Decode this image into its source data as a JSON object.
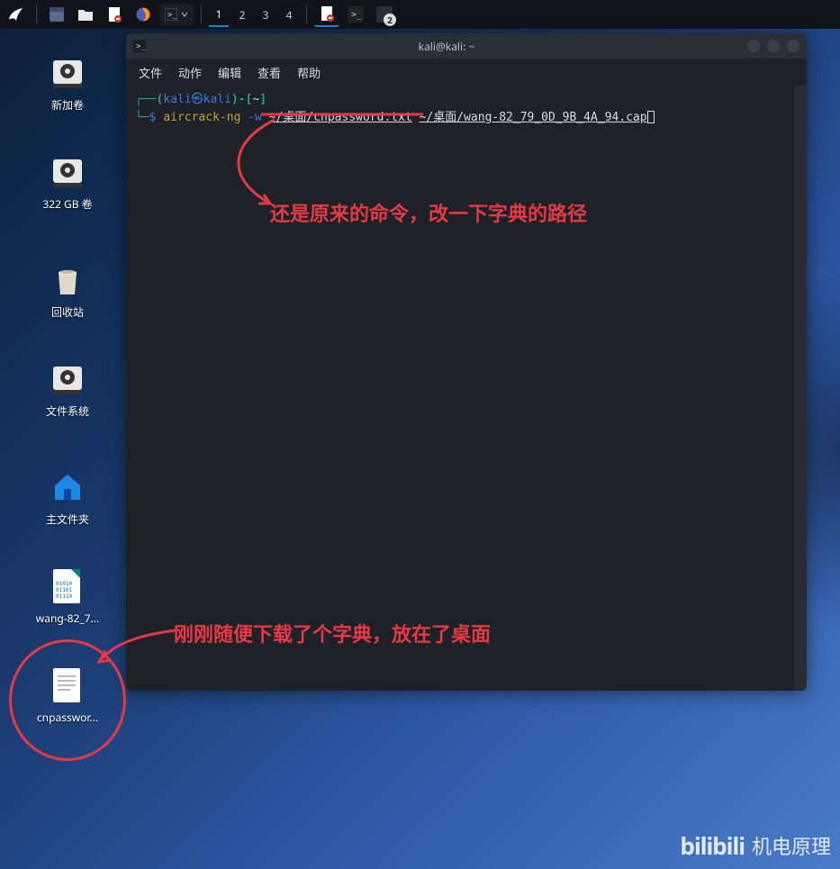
{
  "taskbar": {
    "workspaces": [
      "1",
      "2",
      "3",
      "4"
    ],
    "badge": "2"
  },
  "desktop": {
    "icons": [
      {
        "label": "新加卷",
        "type": "drive"
      },
      {
        "label": "322 GB 卷",
        "type": "drive"
      },
      {
        "label": "回收站",
        "type": "trash"
      },
      {
        "label": "文件系统",
        "type": "drive"
      },
      {
        "label": "主文件夹",
        "type": "home"
      },
      {
        "label": "wang-82_7...",
        "type": "capfile"
      },
      {
        "label": "cnpasswor...",
        "type": "textfile"
      }
    ]
  },
  "terminal": {
    "title": "kali@kali: ~",
    "menu": [
      "文件",
      "动作",
      "编辑",
      "查看",
      "帮助"
    ],
    "prompt_open": "┌──(",
    "user": "kali",
    "at": "㉿",
    "host": "kali",
    "prompt_close": ")-[",
    "cwd": "~",
    "prompt_close2": "]",
    "prompt2_prefix": "└─",
    "dollar": "$",
    "cmd": "aircrack-ng",
    "flag": "-w",
    "arg1": "~/桌面/cnpassword.txt",
    "arg2": "~/桌面/wang-82_79_0D_9B_4A_94.cap"
  },
  "annotations": {
    "a1": "还是原来的命令，改一下字典的路径",
    "a2": "刚刚随便下载了个字典，放在了桌面"
  },
  "watermark": {
    "logo": "bilibili",
    "text": "机电原理"
  }
}
